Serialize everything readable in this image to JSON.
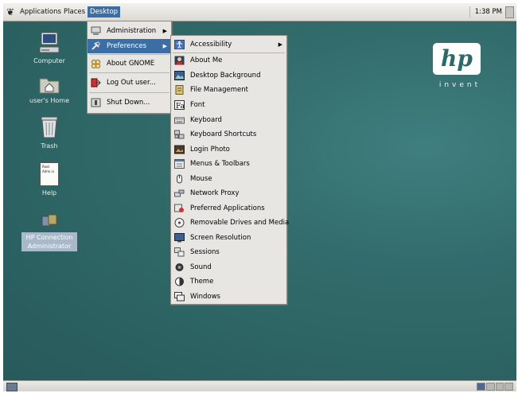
{
  "top_panel": {
    "menus": [
      "Applications",
      "Places",
      "Desktop"
    ],
    "clock": "1:38 PM"
  },
  "desktop_icons": [
    {
      "label": "Computer",
      "icon": "computer-icon"
    },
    {
      "label": "user's Home",
      "icon": "home-folder-icon"
    },
    {
      "label": "Trash",
      "icon": "trash-icon"
    },
    {
      "label": "Help",
      "icon": "help-document-icon",
      "glyph_text": "Root\nAdmi.ni"
    },
    {
      "label": "HP Connection Administrator",
      "icon": "hp-connection-icon"
    }
  ],
  "hp_logo": {
    "mark": "hp",
    "tagline": "invent"
  },
  "desktop_menu": {
    "items": [
      {
        "label": "Administration",
        "icon": "administration-icon",
        "submenu": true
      },
      {
        "label": "Preferences",
        "icon": "preferences-icon",
        "submenu": true,
        "highlighted": true
      },
      {
        "label": "About GNOME",
        "icon": "gnome-foot-icon"
      },
      {
        "label": "Log Out user...",
        "icon": "log-out-icon"
      },
      {
        "label": "Shut Down...",
        "icon": "shut-down-icon"
      }
    ]
  },
  "preferences_menu": {
    "items": [
      {
        "label": "Accessibility",
        "icon": "accessibility-icon",
        "submenu": true
      },
      {
        "label": "About Me",
        "icon": "about-me-icon"
      },
      {
        "label": "Desktop Background",
        "icon": "desktop-background-icon"
      },
      {
        "label": "File Management",
        "icon": "file-management-icon"
      },
      {
        "label": "Font",
        "icon": "font-icon"
      },
      {
        "label": "Keyboard",
        "icon": "keyboard-icon"
      },
      {
        "label": "Keyboard Shortcuts",
        "icon": "keyboard-shortcuts-icon"
      },
      {
        "label": "Login Photo",
        "icon": "login-photo-icon"
      },
      {
        "label": "Menus & Toolbars",
        "icon": "menus-toolbars-icon"
      },
      {
        "label": "Mouse",
        "icon": "mouse-icon"
      },
      {
        "label": "Network Proxy",
        "icon": "network-proxy-icon"
      },
      {
        "label": "Preferred Applications",
        "icon": "preferred-applications-icon"
      },
      {
        "label": "Removable Drives and Media",
        "icon": "removable-drives-icon"
      },
      {
        "label": "Screen Resolution",
        "icon": "screen-resolution-icon"
      },
      {
        "label": "Sessions",
        "icon": "sessions-icon"
      },
      {
        "label": "Sound",
        "icon": "sound-icon"
      },
      {
        "label": "Theme",
        "icon": "theme-icon"
      },
      {
        "label": "Windows",
        "icon": "windows-icon"
      }
    ]
  },
  "colors": {
    "desktop": "#2f6868",
    "highlight": "#3b6ea5",
    "menu_bg": "#e8e6e2"
  }
}
